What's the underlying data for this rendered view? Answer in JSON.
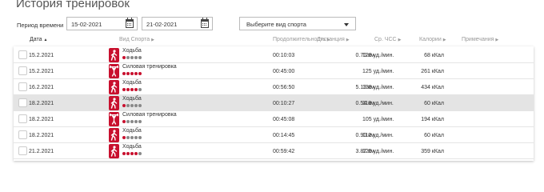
{
  "title": "История тренировок",
  "filters": {
    "period_label": "Период времени",
    "date_from": "15-02-2021",
    "date_to": "21-02-2021",
    "sport_select": "Выберите вид спорта"
  },
  "columns": {
    "date": "Дата",
    "sport": "Вид Спорта",
    "duration": "Продолжительность",
    "distance": "Дистанция",
    "avg_hr": "Ср. ЧСС",
    "calories": "Калории",
    "notes": "Примечания"
  },
  "colors": {
    "accent": "#c8102e",
    "dot_inactive": "#888888",
    "highlight_row": "#e4e4e4"
  },
  "rows": [
    {
      "date": "15.2.2021",
      "sport": "Ходьба",
      "icon": "walking-icon",
      "intensity": 1,
      "duration": "00:10:03",
      "distance": "0.70 км",
      "hr": "128 уд./мин.",
      "calories": "68 кКал",
      "highlight": false
    },
    {
      "date": "15.2.2021",
      "sport": "Силовая тренировка",
      "icon": "strength-icon",
      "intensity": 5,
      "duration": "00:45:00",
      "distance": "",
      "hr": "125 уд./мин.",
      "calories": "261 кКал",
      "highlight": false
    },
    {
      "date": "16.2.2021",
      "sport": "Ходьба",
      "icon": "walking-icon",
      "intensity": 4,
      "duration": "00:56:50",
      "distance": "5.13 км",
      "hr": "138 уд./мин.",
      "calories": "434 кКал",
      "highlight": false
    },
    {
      "date": "18.2.2021",
      "sport": "Ходьба",
      "icon": "walking-icon",
      "intensity": 1,
      "duration": "00:10:27",
      "distance": "0.54 км",
      "hr": "118 уд./мин.",
      "calories": "60 кКал",
      "highlight": true
    },
    {
      "date": "18.2.2021",
      "sport": "Силовая тренировка",
      "icon": "strength-icon",
      "intensity": 1,
      "duration": "00:45:08",
      "distance": "",
      "hr": "105 уд./мин.",
      "calories": "194 кКал",
      "highlight": false
    },
    {
      "date": "18.2.2021",
      "sport": "Ходьба",
      "icon": "walking-icon",
      "intensity": 1,
      "duration": "00:14:45",
      "distance": "0.90 км",
      "hr": "112 уд./мин.",
      "calories": "60 кКал",
      "highlight": false
    },
    {
      "date": "21.2.2021",
      "sport": "Ходьба",
      "icon": "walking-icon",
      "intensity": 4,
      "duration": "00:59:42",
      "distance": "3.87 км",
      "hr": "125 уд./мин.",
      "calories": "359 кКал",
      "highlight": false
    }
  ]
}
